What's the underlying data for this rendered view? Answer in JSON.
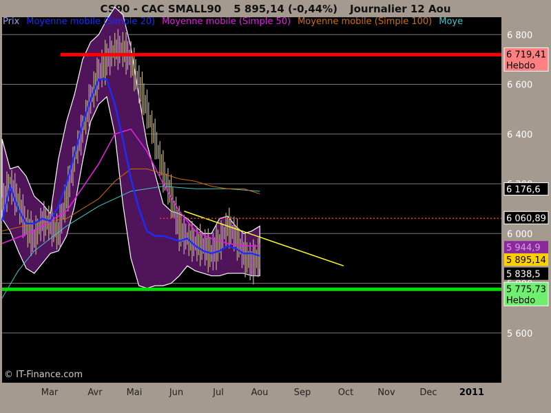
{
  "header": {
    "symbol": "CS90 - CAC SMALL90",
    "price_change": "5 895,14 (-0,44%)",
    "period": "Journalier 12 Aou"
  },
  "credit": "© IT-Finance.com",
  "colors": {
    "background": "#000000",
    "frame": "#a49a8f",
    "band": "#50145a",
    "price_bars": "#b8a88a",
    "ma20": "#1a2dff",
    "ma50": "#e020e0",
    "ma100": "#d07000",
    "ma_other": "#40c8c8",
    "resistance": "#ff0000",
    "support": "#00dd00",
    "dotted": "#ff3030",
    "trendline": "#ffff20"
  },
  "chart_data": {
    "type": "line",
    "title": "CS90 - CAC SMALL90",
    "legend": [
      {
        "name": "Prix",
        "color": "#a0a0ff"
      },
      {
        "name": "Moyenne mobile (Simple 20)",
        "color": "#1a2dff"
      },
      {
        "name": "Moyenne mobile (Simple 50)",
        "color": "#e020e0"
      },
      {
        "name": "Moyenne mobile (Simple 100)",
        "color": "#d07000"
      },
      {
        "name": "Moye",
        "color": "#40c8c8"
      }
    ],
    "x_tick_labels": [
      "Mar",
      "Avr",
      "Mai",
      "Jun",
      "Jul",
      "Aou",
      "Sep",
      "Oct",
      "Nov",
      "Dec",
      "2011"
    ],
    "y_tick_labels": [
      "6 800",
      "6 600",
      "6 400",
      "6 200",
      "6 000",
      "5 800",
      "5 600"
    ],
    "y_ticks": [
      6800,
      6600,
      6400,
      6200,
      6000,
      5800,
      5600
    ],
    "ylim": [
      5400,
      6870
    ],
    "grid": true,
    "legend_position": "top-left",
    "horizontal_lines": [
      {
        "value": 6719.41,
        "label": "6 719,41",
        "sublabel": "Hebdo",
        "color": "#ff0000",
        "style": "solid"
      },
      {
        "value": 5775.73,
        "label": "5 775,73",
        "sublabel": "Hebdo",
        "color": "#00dd00",
        "style": "solid"
      },
      {
        "value": 6060.89,
        "label": "6 060,89",
        "color": "#ff3030",
        "style": "dotted"
      },
      {
        "value": 6176.6,
        "label": "6 176,6",
        "color": "#ffffff",
        "style": "thin"
      }
    ],
    "right_value_labels": [
      {
        "value": 5944.9,
        "label": "5 944,9",
        "bg": "#8a2a9a",
        "fg": "#d9a0e8"
      },
      {
        "value": 5895.14,
        "label": "5 895,14",
        "bg": "#ffd000",
        "fg": "#000000"
      },
      {
        "value": 5838.5,
        "label": "5 838,5",
        "bg": "#000000",
        "fg": "#ffffff"
      }
    ],
    "series": [
      {
        "name": "Prix",
        "x": [
          0,
          5,
          10,
          15,
          20,
          25,
          30,
          35,
          40,
          45,
          50,
          55,
          60,
          65,
          70,
          75,
          80,
          85,
          90,
          95,
          100,
          105,
          110,
          115,
          120,
          125,
          130,
          135,
          140,
          145,
          150,
          155,
          160
        ],
        "values": [
          6120,
          6200,
          6130,
          6030,
          5980,
          6050,
          6040,
          6000,
          6150,
          6300,
          6420,
          6540,
          6640,
          6700,
          6740,
          6740,
          6700,
          6600,
          6500,
          6380,
          6250,
          6150,
          6020,
          5980,
          5960,
          5950,
          5920,
          5960,
          6030,
          5990,
          5920,
          5880,
          5910
        ]
      },
      {
        "name": "Bande haute",
        "x": [
          0,
          5,
          10,
          15,
          20,
          25,
          30,
          35,
          40,
          45,
          50,
          55,
          60,
          65,
          70,
          75,
          80,
          85,
          90,
          95,
          100,
          105,
          110,
          115,
          120,
          125,
          130,
          135,
          140,
          145,
          150,
          155,
          160
        ],
        "values": [
          6380,
          6260,
          6270,
          6230,
          6150,
          6120,
          6080,
          6300,
          6450,
          6560,
          6700,
          6770,
          6800,
          6860,
          6910,
          6880,
          6750,
          6550,
          6360,
          6240,
          6120,
          6090,
          6080,
          6060,
          6030,
          6000,
          6000,
          6060,
          6070,
          6030,
          6000,
          6010,
          6030
        ]
      },
      {
        "name": "Bande basse",
        "x": [
          0,
          5,
          10,
          15,
          20,
          25,
          30,
          35,
          40,
          45,
          50,
          55,
          60,
          65,
          70,
          75,
          80,
          85,
          90,
          95,
          100,
          105,
          110,
          115,
          120,
          125,
          130,
          135,
          140,
          145,
          150,
          155,
          160
        ],
        "values": [
          6060,
          6010,
          5930,
          5860,
          5840,
          5880,
          5920,
          5930,
          5990,
          6110,
          6290,
          6450,
          6520,
          6550,
          6400,
          6120,
          5900,
          5790,
          5780,
          5790,
          5790,
          5800,
          5830,
          5870,
          5850,
          5840,
          5830,
          5830,
          5840,
          5840,
          5840,
          5830,
          5830
        ]
      },
      {
        "name": "Moyenne mobile (Simple 20)",
        "x": [
          0,
          5,
          10,
          15,
          20,
          25,
          30,
          35,
          40,
          45,
          50,
          55,
          60,
          65,
          70,
          75,
          80,
          85,
          90,
          95,
          100,
          105,
          110,
          115,
          120,
          125,
          130,
          135,
          140,
          145,
          150,
          155,
          160
        ],
        "values": [
          6050,
          6190,
          6100,
          6040,
          6040,
          6060,
          6050,
          6110,
          6200,
          6320,
          6440,
          6540,
          6620,
          6620,
          6520,
          6380,
          6220,
          6100,
          6010,
          5990,
          5990,
          5980,
          5970,
          5980,
          5950,
          5930,
          5920,
          5930,
          5950,
          5940,
          5920,
          5920,
          5910
        ]
      },
      {
        "name": "Moyenne mobile (Simple 50)",
        "x": [
          0,
          20,
          40,
          60,
          70,
          80,
          90,
          100,
          110,
          120,
          130,
          140,
          150,
          160
        ],
        "values": [
          5960,
          6010,
          6090,
          6280,
          6400,
          6420,
          6330,
          6200,
          6090,
          6010,
          5980,
          5960,
          5950,
          5950
        ]
      },
      {
        "name": "Moyenne mobile (Simple 100)",
        "x": [
          0,
          20,
          40,
          60,
          70,
          80,
          90,
          100,
          110,
          120,
          130,
          140,
          150,
          160
        ],
        "values": [
          6010,
          6040,
          6060,
          6140,
          6210,
          6260,
          6260,
          6240,
          6220,
          6210,
          6190,
          6180,
          6180,
          6160
        ]
      },
      {
        "name": "Moye",
        "x": [
          0,
          10,
          20,
          40,
          60,
          80,
          100,
          120,
          140,
          160
        ],
        "values": [
          5740,
          5850,
          5930,
          6030,
          6110,
          6170,
          6190,
          6180,
          6180,
          6170
        ]
      },
      {
        "name": "Tendance",
        "x": [
          113,
          212
        ],
        "values": [
          6090,
          5870
        ]
      }
    ]
  }
}
